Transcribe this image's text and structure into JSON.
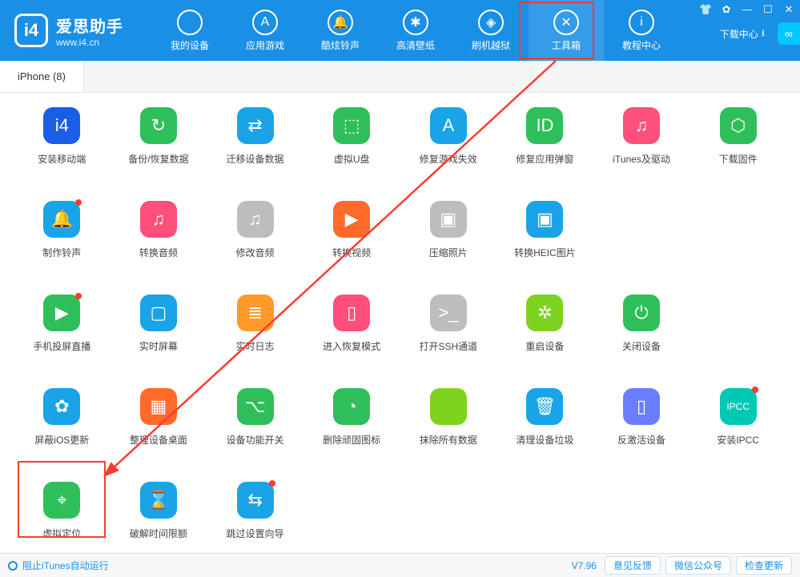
{
  "app": {
    "title": "爱思助手",
    "subtitle": "www.i4.cn"
  },
  "nav": [
    {
      "label": "我的设备",
      "glyph": ""
    },
    {
      "label": "应用游戏",
      "glyph": "A"
    },
    {
      "label": "酷炫铃声",
      "glyph": "🔔"
    },
    {
      "label": "高清壁纸",
      "glyph": "✱"
    },
    {
      "label": "刷机越狱",
      "glyph": "◈"
    },
    {
      "label": "工具箱",
      "glyph": "✕",
      "active": true
    },
    {
      "label": "教程中心",
      "glyph": "i"
    }
  ],
  "download_center": "下载中心",
  "tab": {
    "label": "iPhone (8)"
  },
  "tools": [
    {
      "label": "安装移动端",
      "bg": "#1a5ee6",
      "glyph": "i4"
    },
    {
      "label": "备份/恢复数据",
      "bg": "#2fbf5a",
      "glyph": "↻"
    },
    {
      "label": "迁移设备数据",
      "bg": "#1aa3e6",
      "glyph": "⇄"
    },
    {
      "label": "虚拟U盘",
      "bg": "#2fbf5a",
      "glyph": "⬚"
    },
    {
      "label": "修复游戏失效",
      "bg": "#1aa3e6",
      "glyph": "A"
    },
    {
      "label": "修复应用弹窗",
      "bg": "#2fbf5a",
      "glyph": "ID"
    },
    {
      "label": "iTunes及驱动",
      "bg": "#ff4f7b",
      "glyph": "♫"
    },
    {
      "label": "下载固件",
      "bg": "#2fbf5a",
      "glyph": "⬡"
    },
    {
      "label": "制作铃声",
      "bg": "#1aa3e6",
      "glyph": "🔔",
      "dot": true
    },
    {
      "label": "转换音频",
      "bg": "#ff4f7b",
      "glyph": "♫"
    },
    {
      "label": "修改音频",
      "bg": "#bdbdbd",
      "glyph": "♫"
    },
    {
      "label": "转换视频",
      "bg": "#ff6a2a",
      "glyph": "▶"
    },
    {
      "label": "压缩照片",
      "bg": "#bdbdbd",
      "glyph": "▣"
    },
    {
      "label": "转换HEIC图片",
      "bg": "#1aa3e6",
      "glyph": "▣"
    },
    {
      "label": "",
      "blank": true
    },
    {
      "label": "",
      "blank": true
    },
    {
      "label": "手机投屏直播",
      "bg": "#2fbf5a",
      "glyph": "▶",
      "dot": true
    },
    {
      "label": "实时屏幕",
      "bg": "#1aa3e6",
      "glyph": "▢"
    },
    {
      "label": "实时日志",
      "bg": "#ff9a2a",
      "glyph": "≣"
    },
    {
      "label": "进入恢复模式",
      "bg": "#ff4f7b",
      "glyph": "▯"
    },
    {
      "label": "打开SSH通道",
      "bg": "#bdbdbd",
      "glyph": ">_"
    },
    {
      "label": "重启设备",
      "bg": "#7ed321",
      "glyph": "✲"
    },
    {
      "label": "关闭设备",
      "bg": "#2fbf5a",
      "glyph": "⏻"
    },
    {
      "label": "",
      "blank": true
    },
    {
      "label": "屏蔽iOS更新",
      "bg": "#1aa3e6",
      "glyph": "✿"
    },
    {
      "label": "整理设备桌面",
      "bg": "#ff6a2a",
      "glyph": "▦"
    },
    {
      "label": "设备功能开关",
      "bg": "#2fbf5a",
      "glyph": "⌥"
    },
    {
      "label": "删除顽固图标",
      "bg": "#2fbf5a",
      "glyph": "◔"
    },
    {
      "label": "抹除所有数据",
      "bg": "#7ed321",
      "glyph": ""
    },
    {
      "label": "清理设备垃圾",
      "bg": "#1aa3e6",
      "glyph": "🗑"
    },
    {
      "label": "反激活设备",
      "bg": "#6a7dff",
      "glyph": "▯"
    },
    {
      "label": "安装IPCC",
      "bg": "#00c8b4",
      "glyph": "IPCC",
      "dot": true
    },
    {
      "label": "虚拟定位",
      "bg": "#2fbf5a",
      "glyph": "⌖"
    },
    {
      "label": "破解时间限额",
      "bg": "#1aa3e6",
      "glyph": "⌛"
    },
    {
      "label": "跳过设置向导",
      "bg": "#1aa3e6",
      "glyph": "⇆",
      "dot": true
    },
    {
      "label": "",
      "blank": true
    },
    {
      "label": "",
      "blank": true
    },
    {
      "label": "",
      "blank": true
    },
    {
      "label": "",
      "blank": true
    },
    {
      "label": "",
      "blank": true
    }
  ],
  "status": {
    "left": "阻止iTunes自动运行",
    "version": "V7.96",
    "btn1": "意见反馈",
    "btn2": "微信公众号",
    "btn3": "检查更新"
  }
}
